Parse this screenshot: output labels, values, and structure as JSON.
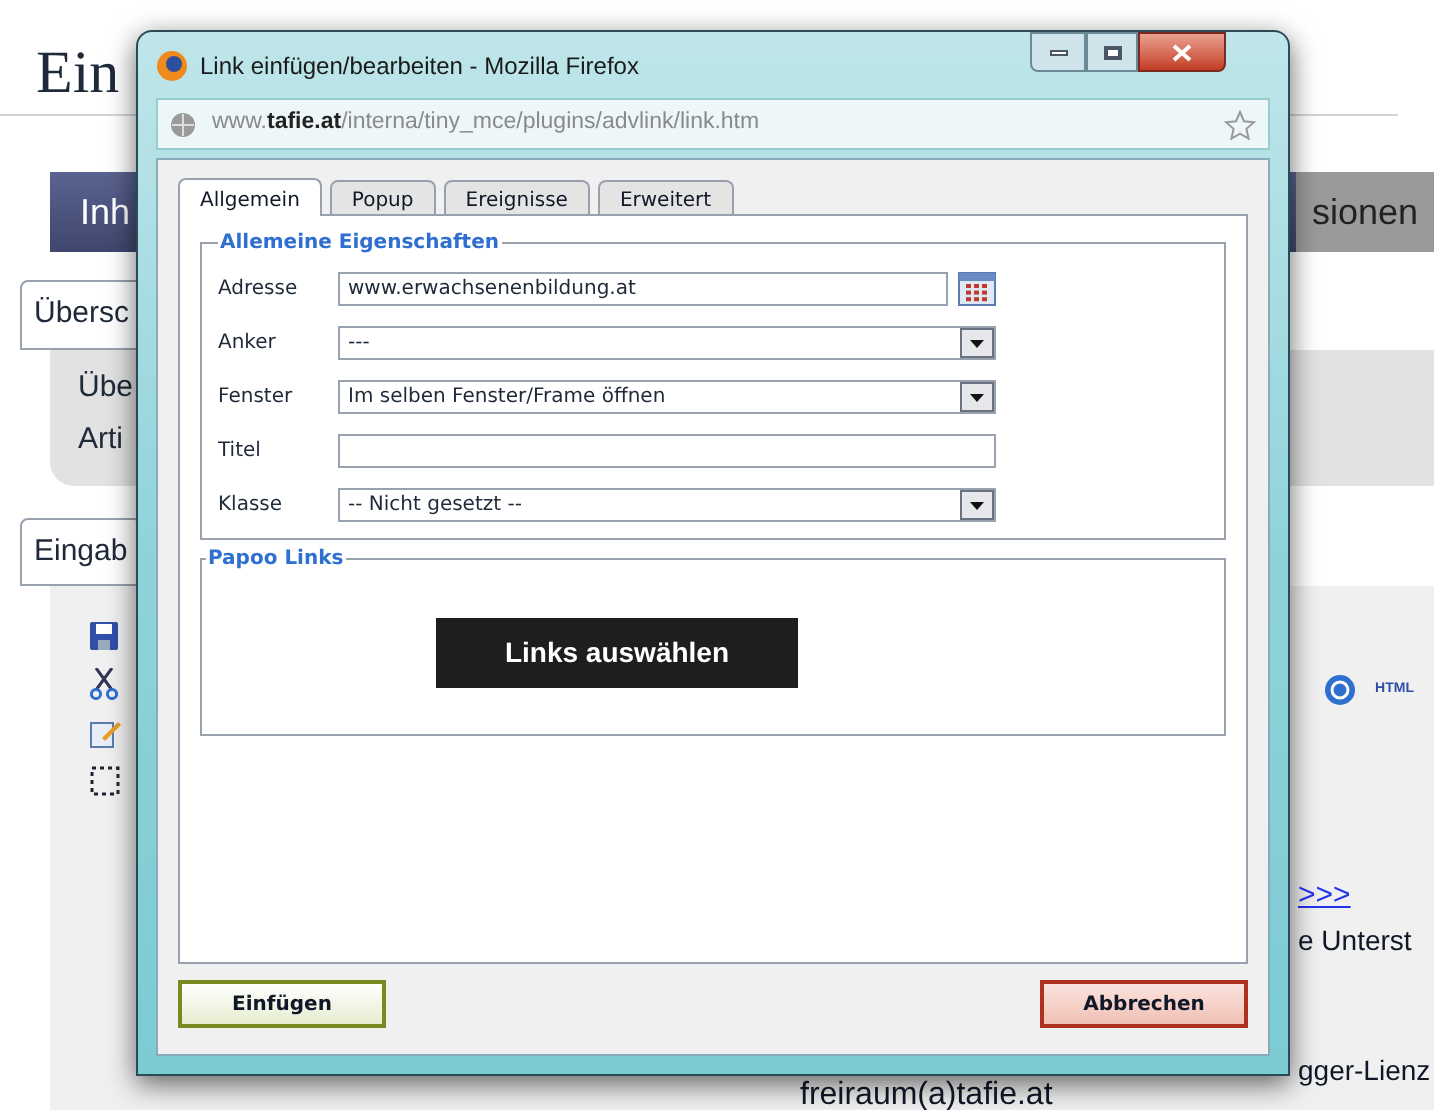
{
  "page": {
    "heading": "Ein",
    "nav": [
      "Inh",
      "sionen"
    ],
    "top_tab": "Übersc",
    "panel_items": [
      "Übe",
      "Arti"
    ],
    "input_tab": "Eingab",
    "editor": {
      "html_label": "HTML",
      "link": ">>>",
      "texts": [
        "e Unterst",
        "gger-Lienz"
      ],
      "contact": "freiraum(a)tafie.at"
    }
  },
  "dialog": {
    "title": "Link einfügen/bearbeiten - Mozilla Firefox",
    "url": "www.**tafie.at**/interna/tiny_mce/plugins/advlink/link.htm",
    "tabs": [
      {
        "label": "Allgemein",
        "selected": true
      },
      {
        "label": "Popup",
        "selected": false
      },
      {
        "label": "Ereignisse",
        "selected": false
      },
      {
        "label": "Erweitert",
        "selected": false
      }
    ],
    "general": {
      "legend": "Allemeine Eigenschaften",
      "fields": [
        {
          "kind": "picker",
          "label": "Adresse",
          "value": "www.erwachsenenbildung.at"
        },
        {
          "kind": "select",
          "label": "Anker",
          "value": "---"
        },
        {
          "kind": "select",
          "label": "Fenster",
          "value": "Im selben Fenster/Frame öffnen"
        },
        {
          "kind": "text",
          "label": "Titel"
        },
        {
          "kind": "select",
          "label": "Klasse",
          "value": "-- Nicht gesetzt --"
        }
      ]
    },
    "papoo": {
      "legend": "Papoo Links",
      "button": "Links auswählen"
    },
    "buttons": [
      {
        "kind": "insert",
        "label": "Einfügen"
      },
      {
        "kind": "cancel",
        "label": "Abbrechen"
      }
    ]
  }
}
